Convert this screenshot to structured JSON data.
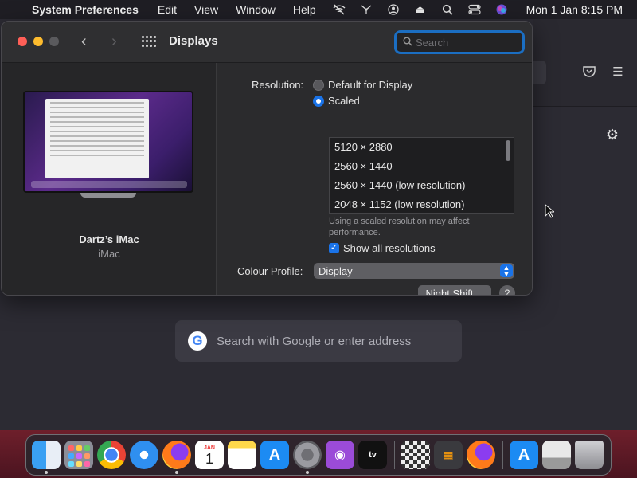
{
  "menubar": {
    "app_name": "System Preferences",
    "items": [
      "Edit",
      "View",
      "Window",
      "Help"
    ],
    "clock": "Mon 1 Jan  8:15 PM"
  },
  "window": {
    "title": "Displays",
    "search_placeholder": "Search"
  },
  "device": {
    "name": "Dartz’s iMac",
    "type": "iMac"
  },
  "display": {
    "resolution_label": "Resolution:",
    "options": {
      "default": "Default for Display",
      "scaled": "Scaled"
    },
    "selected": "scaled",
    "resolutions": [
      "5120 × 2880",
      "2560 × 1440",
      "2560 × 1440 (low resolution)",
      "2048 × 1152 (low resolution)"
    ],
    "note": "Using a scaled resolution may affect performance.",
    "show_all_label": "Show all resolutions",
    "show_all_checked": true,
    "colour_profile_label": "Colour Profile:",
    "colour_profile_value": "Display",
    "night_shift_label": "Night Shift…",
    "help_label": "?"
  },
  "browser": {
    "search_placeholder": "Search with Google or enter address",
    "google_letter": "G"
  },
  "dock": {
    "items": [
      "finder-icon",
      "launchpad-icon",
      "chrome-icon",
      "safari-icon",
      "firefox-icon",
      "calendar-icon",
      "notes-icon",
      "app-store-icon",
      "system-preferences-icon",
      "podcasts-icon",
      "apple-tv-icon",
      "chess-icon",
      "calculator-icon",
      "firefox-icon",
      "app-store-icon",
      "preview-icon",
      "trash-icon"
    ],
    "calendar_month": "JAN",
    "calendar_day": "1",
    "tv_label": "tv"
  },
  "colors": {
    "accent": "#1a73e8",
    "close": "#ff5f57",
    "minimize": "#febc2e"
  }
}
